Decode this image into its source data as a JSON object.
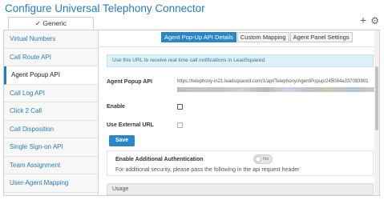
{
  "page": {
    "title": "Configure Universal Telephony Connector"
  },
  "top_tab": {
    "label": "✓ Generic"
  },
  "toolbar": {
    "plus_icon": "+",
    "gear_icon": "⚙"
  },
  "sidebar": {
    "items": [
      {
        "label": "Virtual Numbers"
      },
      {
        "label": "Call Route API"
      },
      {
        "label": "Agent Popup API"
      },
      {
        "label": "Call Log API"
      },
      {
        "label": "Click 2 Call"
      },
      {
        "label": "Call Disposition"
      },
      {
        "label": "Single Sign-on API"
      },
      {
        "label": "Team Assignment"
      },
      {
        "label": "User-Agent Mapping"
      }
    ],
    "active_index": 2
  },
  "subtabs": [
    {
      "label": "Agent Pop-Up API Details"
    },
    {
      "label": "Custom Mapping"
    },
    {
      "label": "Agent Panel Settings"
    }
  ],
  "info": {
    "text": "Use this URL to receive real time call notifications in LeadSquared."
  },
  "form": {
    "popup_api_label": "Agent Popup API",
    "popup_api_url": "https://telephony-in21.leadsquared.com/1/api/Telephony/AgentPopup/245084a337093901",
    "enable_label": "Enable",
    "external_url_label": "Use External URL",
    "save_label": "Save"
  },
  "auth": {
    "title": "Enable Additional Authentication",
    "toggle_text": "No",
    "description": "For additional security, please pass the following in the api request header"
  },
  "usage": {
    "label": "Usage"
  },
  "colors": {
    "accent": "#2b86c5",
    "title": "#2b7bb9",
    "info_bg": "#dff1f7"
  }
}
